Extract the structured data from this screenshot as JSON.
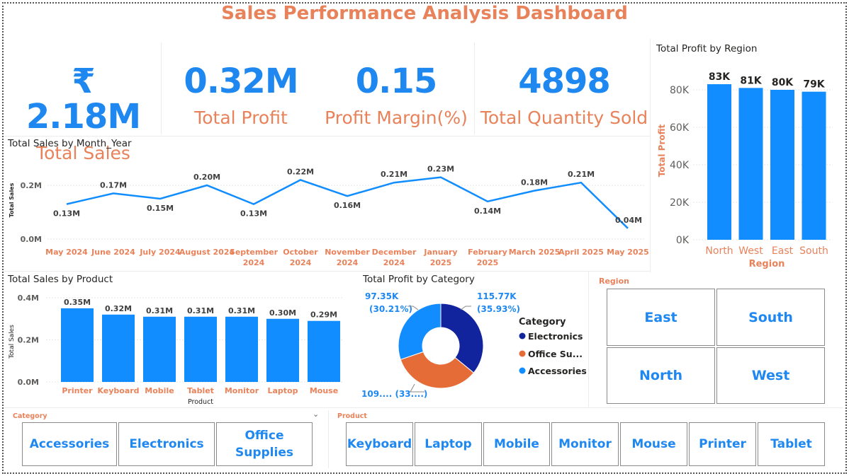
{
  "dashboard_title": "Sales Performance Analysis Dashboard",
  "kpis": [
    {
      "value": "₹ 2.18M",
      "label": "Total Sales"
    },
    {
      "value": "0.32M",
      "label": "Total Profit"
    },
    {
      "value": "0.15",
      "label": "Profit Margin(%)"
    },
    {
      "value": "4898",
      "label": "Total Quantity Sold"
    }
  ],
  "colors": {
    "accent": "#1e88f0",
    "title": "#e8825a",
    "dark_blue": "#12239e",
    "orange": "#e66c37",
    "light_blue": "#118dff"
  },
  "region_chart": {
    "title": "Total Profit by Region",
    "ylabel": "Total Profit",
    "xlabel": "Region"
  },
  "month_chart": {
    "title": "Total Sales by Month_Year",
    "ylabel": "Total Sales"
  },
  "product_chart": {
    "title": "Total Sales by Product",
    "ylabel": "Total Sales",
    "xlabel": "Product"
  },
  "category_chart": {
    "title": "Total Profit by Category",
    "legend_title": "Category",
    "legend": [
      "Electronics",
      "Office Su...",
      "Accessories"
    ],
    "labels": {
      "electronics_value": "115.77K",
      "electronics_pct": "(35.93%)",
      "accessories_value": "97.35K",
      "accessories_pct": "(30.21%)",
      "office": "109.... (33....)"
    }
  },
  "chart_data": [
    {
      "type": "bar",
      "title": "Total Profit by Region",
      "categories": [
        "North",
        "West",
        "East",
        "South"
      ],
      "values": [
        83,
        81,
        80,
        79
      ],
      "data_labels": [
        "83K",
        "81K",
        "80K",
        "79K"
      ],
      "yticks": [
        "0K",
        "20K",
        "40K",
        "60K",
        "80K"
      ],
      "ylim": [
        0,
        90
      ],
      "xlabel": "Region",
      "ylabel": "Total Profit"
    },
    {
      "type": "line",
      "title": "Total Sales by Month_Year",
      "categories": [
        "May 2024",
        "June 2024",
        "July 2024",
        "August 2024",
        "September 2024",
        "October 2024",
        "November 2024",
        "December 2024",
        "January 2025",
        "February 2025",
        "March 2025",
        "April 2025",
        "May 2025"
      ],
      "values": [
        0.13,
        0.17,
        0.15,
        0.2,
        0.13,
        0.22,
        0.16,
        0.21,
        0.23,
        0.14,
        0.18,
        0.21,
        0.04
      ],
      "data_labels": [
        "0.13M",
        "0.17M",
        "0.15M",
        "0.20M",
        "0.13M",
        "0.22M",
        "0.16M",
        "0.21M",
        "0.23M",
        "0.14M",
        "0.18M",
        "0.21M",
        "0.04M"
      ],
      "yticks": [
        "0.0M",
        "0.2M"
      ],
      "ylim": [
        0,
        0.28
      ],
      "ylabel": "Total Sales"
    },
    {
      "type": "bar",
      "title": "Total Sales by Product",
      "categories": [
        "Printer",
        "Keyboard",
        "Mobile",
        "Tablet",
        "Monitor",
        "Laptop",
        "Mouse"
      ],
      "values": [
        0.35,
        0.32,
        0.31,
        0.31,
        0.31,
        0.3,
        0.29
      ],
      "data_labels": [
        "0.35M",
        "0.32M",
        "0.31M",
        "0.31M",
        "0.31M",
        "0.30M",
        "0.29M"
      ],
      "yticks": [
        "0.0M",
        "0.2M",
        "0.4M"
      ],
      "ylim": [
        0,
        0.4
      ],
      "xlabel": "Product",
      "ylabel": "Total Sales"
    },
    {
      "type": "pie",
      "title": "Total Profit by Category",
      "categories": [
        "Electronics",
        "Office Supplies",
        "Accessories"
      ],
      "values": [
        115.77,
        109,
        97.35
      ],
      "percent": [
        35.93,
        33.86,
        30.21
      ]
    }
  ],
  "region_slicer": {
    "title": "Region",
    "items": [
      "East",
      "South",
      "North",
      "West"
    ]
  },
  "category_slicer": {
    "title": "Category",
    "items": [
      "Accessories",
      "Electronics",
      "Office\nSupplies"
    ]
  },
  "product_slicer": {
    "title": "Product",
    "items": [
      "Keyboard",
      "Laptop",
      "Mobile",
      "Monitor",
      "Mouse",
      "Printer",
      "Tablet"
    ]
  }
}
